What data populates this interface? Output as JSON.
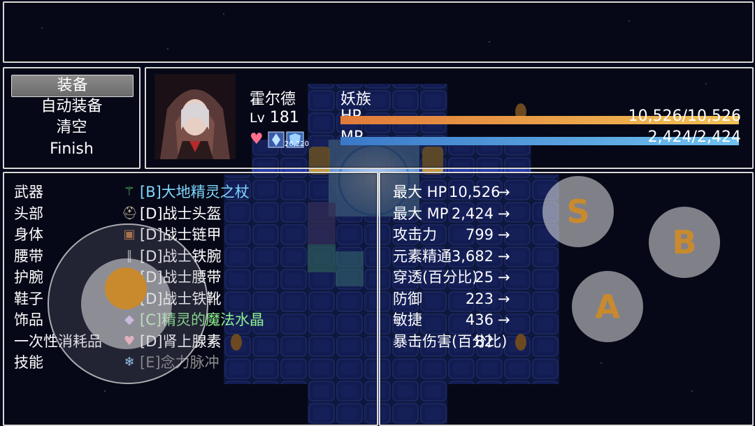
{
  "commands": [
    "装备",
    "自动装备",
    "清空",
    "Finish"
  ],
  "actor": {
    "name": "霍尔德",
    "race": "妖族",
    "level_label": "Lv",
    "level": "181",
    "hp_label": "HP",
    "hp_text": "10,526/10,526",
    "hp_ratio": 1.0,
    "mp_label": "MP",
    "mp_text": "2,424/2,424",
    "mp_ratio": 1.0,
    "state_icons": [
      "heart-icon",
      "crystal-status-icon",
      "shield-status-icon"
    ],
    "state_turns": "26,220"
  },
  "slots": [
    {
      "name": "武器",
      "item": "[B]大地精灵之杖",
      "color": "#7fd8ff",
      "icon": "staff-icon"
    },
    {
      "name": "头部",
      "item": "[D]战士头盔",
      "color": "#ffffff",
      "icon": "helmet-icon"
    },
    {
      "name": "身体",
      "item": "[D]战士链甲",
      "color": "#ffffff",
      "icon": "armor-icon"
    },
    {
      "name": "腰带",
      "item": "[D]战士铁腕",
      "color": "#ffffff",
      "icon": "bracer-icon"
    },
    {
      "name": "护腕",
      "item": "[D]战士腰带",
      "color": "#ffffff",
      "icon": "belt-icon"
    },
    {
      "name": "鞋子",
      "item": "[D]战士铁靴",
      "color": "#ffffff",
      "icon": "boots-icon"
    },
    {
      "name": "饰品",
      "item": "[C]精灵的魔法水晶",
      "color": "#8ef08e",
      "icon": "crystal-icon"
    },
    {
      "name": "一次性消耗品",
      "item": "[D]肾上腺素",
      "color": "#ffffff",
      "icon": "heart-potion-icon"
    },
    {
      "name": "技能",
      "item": "[E]念力脉冲",
      "color": "#8a8a8a",
      "icon": "skill-icon"
    }
  ],
  "params": [
    {
      "name": "最大 HP",
      "value": "10,526"
    },
    {
      "name": "最大 MP",
      "value": "2,424"
    },
    {
      "name": "攻击力",
      "value": "799"
    },
    {
      "name": "元素精通",
      "value": "3,682"
    },
    {
      "name": "穿透(百分比)",
      "value": "25"
    },
    {
      "name": "防御",
      "value": "223"
    },
    {
      "name": "敏捷",
      "value": "436"
    },
    {
      "name": "暴击伤害(百分比)",
      "value": "82"
    }
  ],
  "param_arrow": "→",
  "virtual_buttons": {
    "s": "S",
    "b": "B",
    "a": "A"
  },
  "colors": {
    "hp_gradient": [
      "#e07a3a",
      "#f2c155"
    ],
    "mp_gradient": [
      "#3a78c8",
      "#6fc2f0"
    ],
    "button_text": "#c98a2e"
  }
}
